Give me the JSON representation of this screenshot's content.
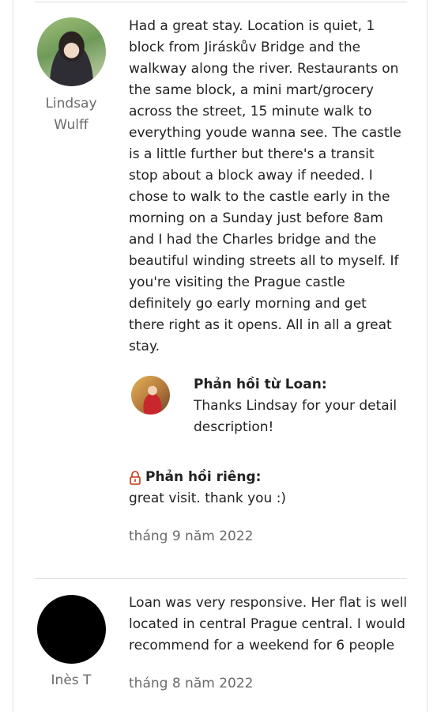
{
  "reviews": [
    {
      "reviewer": "Lindsay\nWulff",
      "text": "Had a great stay. Location is quiet, 1\nblock from Jiráskův Bridge and the\nwalkway along the river. Restaurants on\nthe same block, a mini mart/grocery\nacross the street, 15 minute walk to\neverything youde wanna see. The castle\nis a little further but there's a transit\nstop about a block away if needed. I\nchose to walk to the castle early in the\nmorning on a Sunday just before 8am\nand I had the Charles bridge and the\nbeautiful winding streets all to myself. If\nyou're visiting the Prague castle\ndefinitely go early morning and get\nthere right as it opens. All in all a great\nstay.",
      "host_response": {
        "title": "Phản hồi từ Loan:",
        "text": "Thanks Lindsay for your detail\ndescription!"
      },
      "private_feedback": {
        "icon": "lock-icon",
        "title": "Phản hồi riêng:",
        "text": "great visit. thank you :)"
      },
      "date": "tháng 9 năm 2022"
    },
    {
      "reviewer": "Inès T",
      "text": "Loan was very responsive. Her flat is well\nlocated in central Prague central. I would\nrecommend for a weekend for 6 people",
      "date": "tháng 8 năm 2022"
    }
  ],
  "colors": {
    "text": "#222222",
    "muted": "#6a6a6a",
    "divider": "#dddddd",
    "lock": "#c13515"
  }
}
